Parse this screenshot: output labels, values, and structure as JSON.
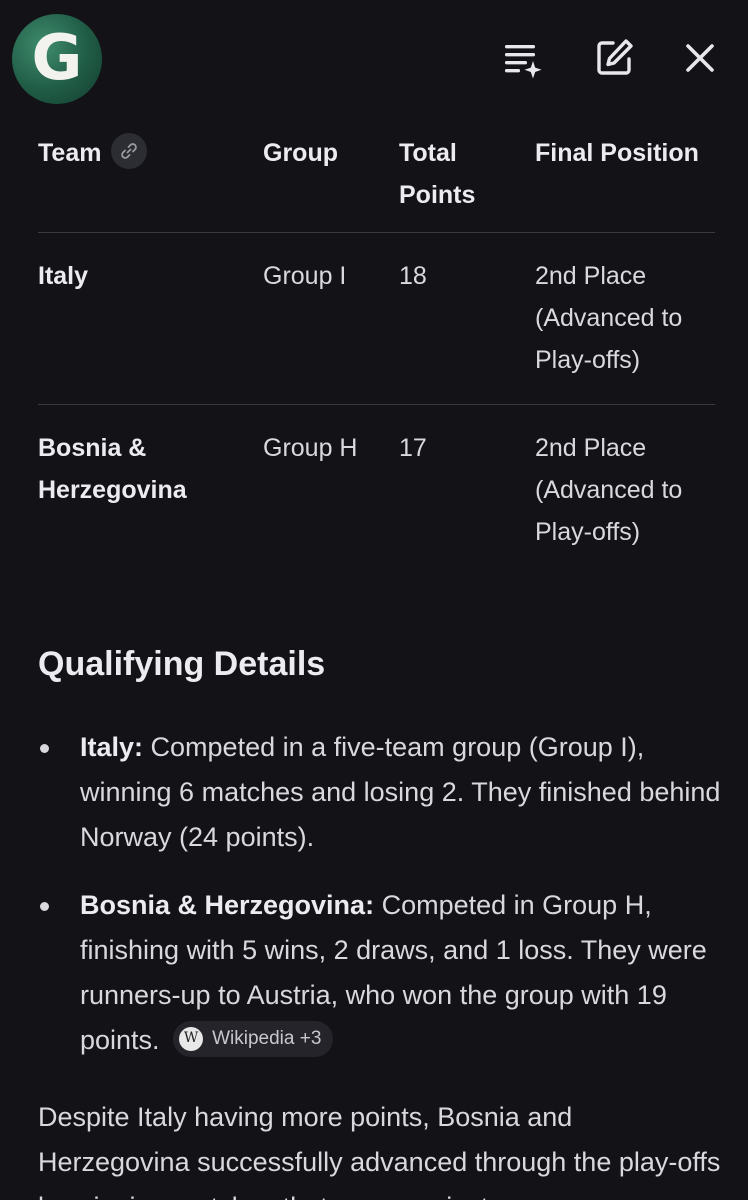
{
  "app": {
    "logo_letter": "G",
    "brand_color": "#1f5b45"
  },
  "icons": {
    "queue": "playlist-sparkle-icon",
    "edit": "edit-square-icon",
    "close": "close-icon",
    "link": "link-icon",
    "wikipedia": "wikipedia-icon"
  },
  "table": {
    "headers": {
      "team": "Team",
      "group": "Group",
      "points": "Total Points",
      "final": "Final Position"
    },
    "rows": [
      {
        "team": "Italy",
        "group": "Group I",
        "points": "18",
        "final": "2nd Place (Advanced to Play-offs)"
      },
      {
        "team": "Bosnia & Herzegovina",
        "group": "Group H",
        "points": "17",
        "final": "2nd Place (Advanced to Play-offs)"
      }
    ]
  },
  "details": {
    "title": "Qualifying Details",
    "bullets": [
      {
        "label": "Italy:",
        "text": " Competed in a five-team group (Group I), winning 6 matches and losing 2. They finished behind Norway (24 points)."
      },
      {
        "label": "Bosnia & Herzegovina:",
        "text": " Competed in Group H, finishing with 5 wins, 2 draws, and 1 loss. They were runners-up to Austria, who won the group with 19 points.",
        "source_logo": "W",
        "source": "Wikipedia +3"
      }
    ],
    "paragraph": "Despite Italy having more points, Bosnia and Herzegovina successfully advanced through the play-offs by winning matches that were against"
  }
}
